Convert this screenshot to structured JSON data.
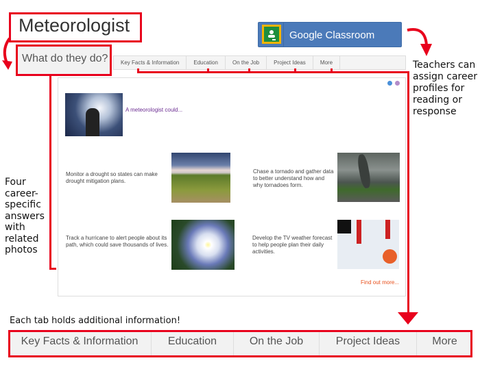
{
  "career": {
    "title": "Meteorologist",
    "section_label": "What do they do?"
  },
  "google_classroom": {
    "label": "Google Classroom",
    "icon": "google-classroom-icon"
  },
  "tabs": [
    {
      "label": "Key Facts & Information"
    },
    {
      "label": "Education"
    },
    {
      "label": "On the Job"
    },
    {
      "label": "Project Ideas"
    },
    {
      "label": "More"
    }
  ],
  "panel": {
    "icons": [
      "home-icon",
      "mail-icon"
    ],
    "intro": "A meteorologist could...",
    "answers": [
      {
        "text": "Monitor a drought so states can make drought mitigation plans.",
        "photo": "wheat-field-storm-sky"
      },
      {
        "text": "Chase a tornado and gather data to better understand how and why tornadoes form.",
        "photo": "tornado-over-road"
      },
      {
        "text": "Track a hurricane to alert people about its path, which could save thousands of lives.",
        "photo": "hurricane-satellite"
      },
      {
        "text": "Develop the TV weather forecast to help people plan their daily activities.",
        "photo": "soccer-in-snow"
      }
    ],
    "find_more": "Find out more..."
  },
  "annotations": {
    "right_note": "Teachers can assign career profiles for reading or response",
    "left_note": "Four career-specific answers with related photos",
    "bottom_caption": "Each tab holds additional information!"
  },
  "colors": {
    "annotation_red": "#e8001c",
    "classroom_blue": "#4b7ab9",
    "intro_purple": "#6b2c91",
    "link_orange": "#e8501c"
  }
}
